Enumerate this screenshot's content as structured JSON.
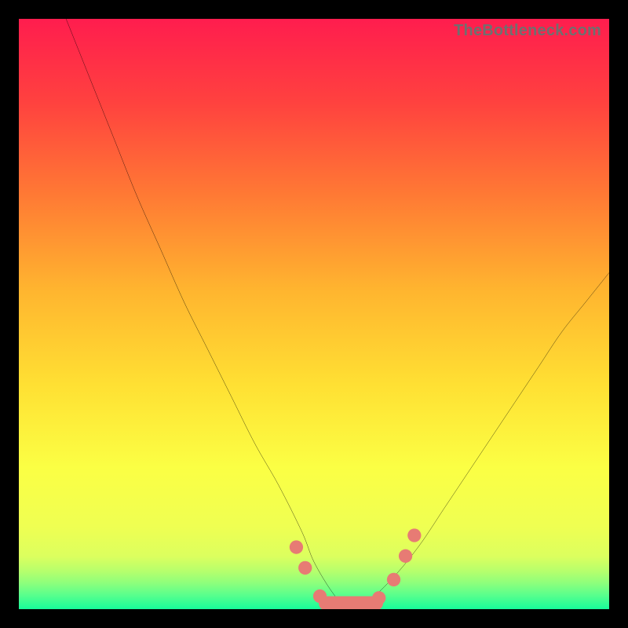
{
  "watermark": "TheBottleneck.com",
  "chart_data": {
    "type": "line",
    "title": "",
    "xlabel": "",
    "ylabel": "",
    "xlim": [
      0,
      100
    ],
    "ylim": [
      0,
      100
    ],
    "gradient_colors_top_to_bottom": [
      "#ff1d4e",
      "#ff5a3e",
      "#ffa733",
      "#ffe033",
      "#f6ff4a",
      "#d7ff5d",
      "#9bff76",
      "#53ff8f",
      "#17fd9a"
    ],
    "series": [
      {
        "name": "bottleneck-curve",
        "x": [
          8,
          12,
          16,
          20,
          24,
          28,
          32,
          36,
          40,
          44,
          48,
          50,
          53,
          55,
          58,
          60,
          64,
          68,
          72,
          76,
          80,
          84,
          88,
          92,
          96,
          100
        ],
        "y": [
          100,
          90,
          80,
          70,
          61,
          52,
          44,
          36,
          28,
          21,
          13,
          8,
          3,
          1,
          1,
          2,
          6,
          11,
          17,
          23,
          29,
          35,
          41,
          47,
          52,
          57
        ]
      }
    ],
    "markers": {
      "name": "highlighted-points",
      "color": "#e77b74",
      "points": [
        {
          "x": 47.0,
          "y": 10.5
        },
        {
          "x": 48.5,
          "y": 7.0
        },
        {
          "x": 51.0,
          "y": 2.2
        },
        {
          "x": 53.5,
          "y": 0.9
        },
        {
          "x": 56.0,
          "y": 0.9
        },
        {
          "x": 58.5,
          "y": 1.0
        },
        {
          "x": 61.0,
          "y": 1.9
        },
        {
          "x": 63.5,
          "y": 5.0
        },
        {
          "x": 65.5,
          "y": 9.0
        },
        {
          "x": 67.0,
          "y": 12.5
        }
      ],
      "segment": {
        "x0": 52.0,
        "x1": 60.5,
        "y": 1.0,
        "thickness": 2.4
      }
    },
    "green_band_fraction": 0.085
  }
}
